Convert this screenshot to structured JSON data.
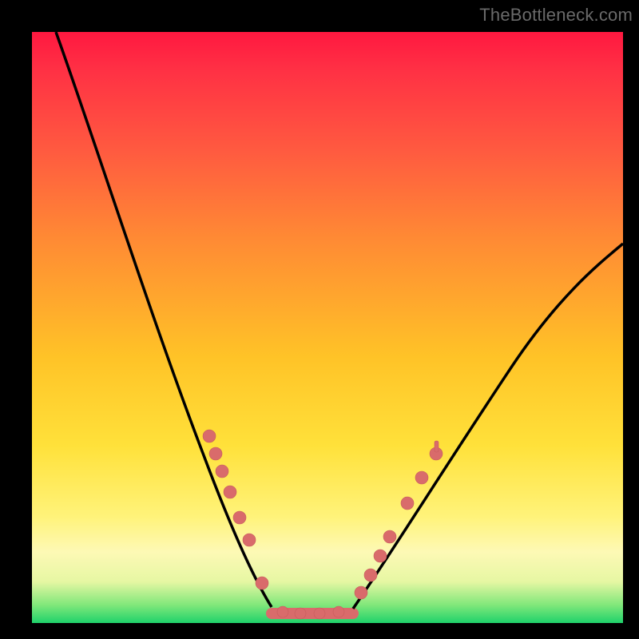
{
  "watermark": "TheBottleneck.com",
  "chart_data": {
    "type": "line",
    "title": "",
    "xlabel": "",
    "ylabel": "",
    "xlim": [
      0,
      100
    ],
    "ylim": [
      0,
      100
    ],
    "legend": false,
    "grid": false,
    "series": [
      {
        "name": "left-curve",
        "x": [
          4,
          10,
          15,
          20,
          25,
          28,
          30,
          32,
          34,
          36,
          38,
          40
        ],
        "y": [
          100,
          82,
          67,
          52,
          37,
          28,
          22,
          16,
          11,
          7,
          4,
          2
        ]
      },
      {
        "name": "bottom-plateau",
        "x": [
          40,
          54
        ],
        "y": [
          1,
          1
        ]
      },
      {
        "name": "right-curve",
        "x": [
          54,
          58,
          62,
          67,
          72,
          78,
          84,
          90,
          96,
          100
        ],
        "y": [
          2,
          6,
          12,
          20,
          28,
          36,
          44,
          52,
          59,
          64
        ]
      }
    ],
    "annotations": {
      "left_cluster_y": [
        31,
        28,
        25,
        22,
        18,
        15
      ],
      "right_cluster_y": [
        6,
        9,
        12,
        15,
        22,
        26,
        29
      ],
      "plateau_dots_x": [
        42,
        45,
        48,
        51
      ]
    }
  },
  "colors": {
    "curve": "#000000",
    "marker": "#d96b6b",
    "background_top": "#ff1840",
    "background_bottom": "#1fd26b",
    "frame": "#000000",
    "watermark": "#6a6a6a"
  }
}
